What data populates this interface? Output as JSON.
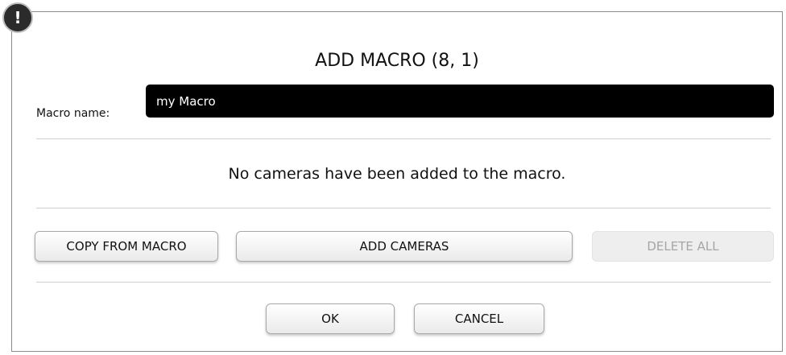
{
  "alert_badge": "!",
  "dialog": {
    "title": "ADD MACRO (8, 1)",
    "macro_name_label": "Macro name:",
    "macro_name_value": "my Macro",
    "empty_message": "No cameras have been added to the macro.",
    "buttons": {
      "copy_from_macro": "COPY FROM MACRO",
      "add_cameras": "ADD CAMERAS",
      "delete_all": "DELETE ALL",
      "ok": "OK",
      "cancel": "CANCEL"
    }
  },
  "colors": {
    "name_field_bg": "#000000",
    "disabled_text": "#a6a6a6"
  },
  "icons": {
    "alert": "exclamation-badge-icon"
  }
}
